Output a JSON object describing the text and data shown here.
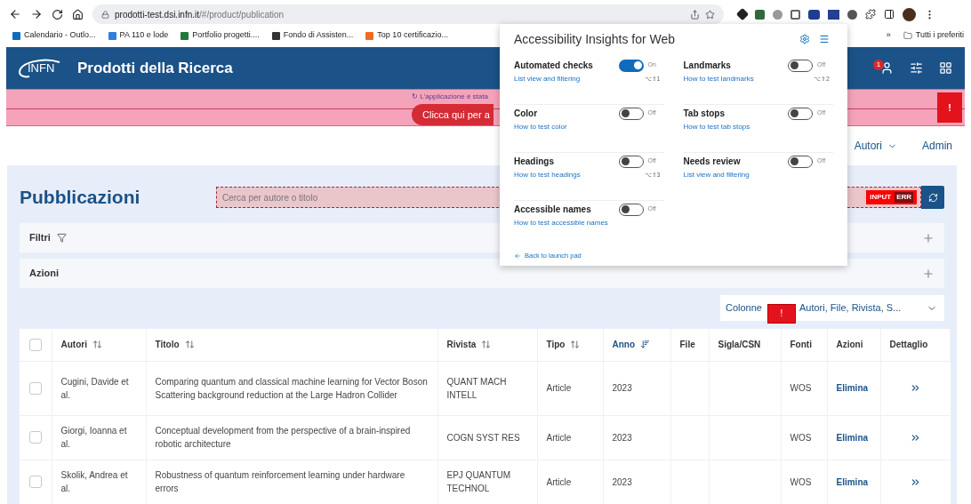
{
  "browser": {
    "url_host": "prodotti-test.dsi.infn.it",
    "url_path": "/#/product/publication",
    "bookmarks": [
      {
        "label": "Calendario - Outlo...",
        "color": "#0f6cbd"
      },
      {
        "label": "PA 110 e lode",
        "color": "#2f7fe0"
      },
      {
        "label": "Portfolio progetti....",
        "color": "#1e7a3c"
      },
      {
        "label": "Fondo di Assisten...",
        "color": "#333333"
      },
      {
        "label": "Top 10 certificazio...",
        "color": "#f26a21"
      }
    ],
    "more": "»",
    "folder": "Tutti i preferiti"
  },
  "app": {
    "logo": "INFN",
    "title": "Prodotti della Ricerca",
    "notification_count": "1"
  },
  "banner": {
    "message": "↻ L'applicazione è stata",
    "button": "Clicca qui per a",
    "flag": "!"
  },
  "nav": [
    {
      "label": "Autori",
      "kind": "menu"
    },
    {
      "label": "Admin",
      "kind": "link"
    }
  ],
  "page": {
    "title": "Pubblicazioni",
    "search": {
      "placeholder": "Cerca per autore o titolo",
      "error_badge": "INPUT",
      "error_code": "ERR"
    },
    "panels": [
      {
        "label": "Filtri",
        "kind": "filter"
      },
      {
        "label": "Azioni",
        "kind": "plain"
      }
    ],
    "columns_picker": {
      "label": "Colonne",
      "flag": "!",
      "value": "Autori, File, Rivista, S..."
    }
  },
  "table": {
    "select_all": {
      "checked": false
    },
    "columns": [
      {
        "label": "Autori",
        "sortable": true,
        "sorted": false
      },
      {
        "label": "Titolo",
        "sortable": true,
        "sorted": false
      },
      {
        "label": "Rivista",
        "sortable": true,
        "sorted": false
      },
      {
        "label": "Tipo",
        "sortable": true,
        "sorted": false
      },
      {
        "label": "Anno",
        "sortable": true,
        "sorted": true
      },
      {
        "label": "File"
      },
      {
        "label": "Sigla/CSN"
      },
      {
        "label": "Fonti"
      },
      {
        "label": "Azioni"
      },
      {
        "label": "Dettaglio"
      }
    ],
    "rows": [
      {
        "checked": false,
        "autori": "Cugini, Davide et al.",
        "titolo": "Comparing quantum and classical machine learning for Vector Boson Scattering background reduction at the Large Hadron Collider",
        "rivista": "QUANT MACH INTELL",
        "tipo": "Article",
        "anno": "2023",
        "fonti": "WOS",
        "azione": "Elimina"
      },
      {
        "checked": false,
        "autori": "Giorgi, Ioanna et al.",
        "titolo": "Conceptual development from the perspective of a brain-inspired robotic architecture",
        "rivista": "COGN SYST RES",
        "tipo": "Article",
        "anno": "2023",
        "fonti": "WOS",
        "azione": "Elimina"
      },
      {
        "checked": false,
        "autori": "Skolik, Andrea et al.",
        "titolo": "Robustness of quantum reinforcement learning under hardware errors",
        "rivista": "EPJ QUANTUM TECHNOL",
        "tipo": "Article",
        "anno": "2023",
        "fonti": "WOS",
        "azione": "Elimina"
      }
    ]
  },
  "popup": {
    "title": "Accessibility Insights for Web",
    "toggles": [
      {
        "name": "Automated checks",
        "on": true,
        "state_label": "On",
        "link": "List view and filtering",
        "shortcut": "⌥⇧1"
      },
      {
        "name": "Landmarks",
        "on": false,
        "state_label": "Off",
        "link": "How to test landmarks",
        "shortcut": "⌥⇧2"
      },
      {
        "name": "Color",
        "on": false,
        "state_label": "Off",
        "link": "How to test color"
      },
      {
        "name": "Tab stops",
        "on": false,
        "state_label": "Off",
        "link": "How to test tab stops"
      },
      {
        "name": "Headings",
        "on": false,
        "state_label": "Off",
        "link": "How to test headings",
        "shortcut": "⌥⇧3"
      },
      {
        "name": "Needs review",
        "on": false,
        "state_label": "Off",
        "link": "List view and filtering"
      },
      {
        "name": "Accessible names",
        "on": false,
        "state_label": "Off",
        "link": "How to test accessible names"
      }
    ],
    "back": "Back to launch pad"
  }
}
